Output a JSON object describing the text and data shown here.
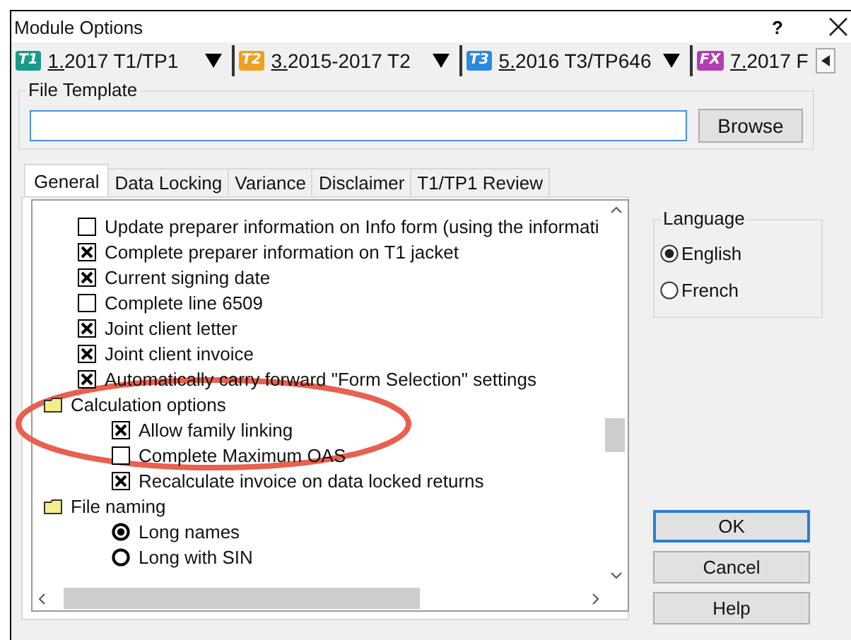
{
  "window": {
    "title": "Module Options",
    "help": "?"
  },
  "modules": [
    {
      "badge": "T1",
      "color": "#1a9a8a",
      "label": "1.2017 T1/TP1",
      "dropdown": true
    },
    {
      "badge": "T2",
      "color": "#f0a020",
      "label": "3.2015-2017 T2",
      "dropdown": true
    },
    {
      "badge": "T3",
      "color": "#2a8ae0",
      "label": "5.2016 T3/TP646",
      "dropdown": true
    },
    {
      "badge": "FX",
      "color": "#b040b0",
      "label": "7.2017 F",
      "dropdown": false
    }
  ],
  "file_template": {
    "label": "File Template",
    "browse": "Browse"
  },
  "tabs": [
    {
      "label": "General",
      "selected": true
    },
    {
      "label": "Data Locking",
      "selected": false
    },
    {
      "label": "Variance",
      "selected": false
    },
    {
      "label": "Disclaimer",
      "selected": false
    },
    {
      "label": "T1/TP1 Review",
      "selected": false
    }
  ],
  "tree": [
    {
      "kind": "checkbox",
      "label": "Update preparer information on Info form (using the informati",
      "checked": false
    },
    {
      "kind": "checkbox",
      "label": "Complete preparer information on T1 jacket",
      "checked": true
    },
    {
      "kind": "checkbox",
      "label": "Current signing date",
      "checked": true
    },
    {
      "kind": "checkbox",
      "label": "Complete line 6509",
      "checked": false
    },
    {
      "kind": "checkbox",
      "label": "Joint client letter",
      "checked": true
    },
    {
      "kind": "checkbox",
      "label": "Joint client invoice",
      "checked": true
    },
    {
      "kind": "checkbox",
      "label": "Automatically carry forward \"Form Selection\" settings",
      "checked": true
    },
    {
      "kind": "folder",
      "label": "Calculation options",
      "children": [
        {
          "kind": "checkbox",
          "label": "Allow family linking",
          "checked": true
        },
        {
          "kind": "checkbox",
          "label": "Complete Maximum OAS",
          "checked": false
        },
        {
          "kind": "checkbox",
          "label": "Recalculate invoice on data locked returns",
          "checked": true
        }
      ]
    },
    {
      "kind": "folder",
      "label": "File naming",
      "children": [
        {
          "kind": "radio",
          "label": "Long names",
          "selected": true
        },
        {
          "kind": "radio",
          "label": "Long with SIN",
          "selected": false
        }
      ]
    }
  ],
  "language": {
    "label": "Language",
    "options": [
      {
        "label": "English",
        "selected": true
      },
      {
        "label": "French",
        "selected": false
      }
    ]
  },
  "buttons": [
    {
      "label": "OK",
      "default": true
    },
    {
      "label": "Cancel",
      "default": false
    },
    {
      "label": "Help",
      "default": false
    }
  ]
}
